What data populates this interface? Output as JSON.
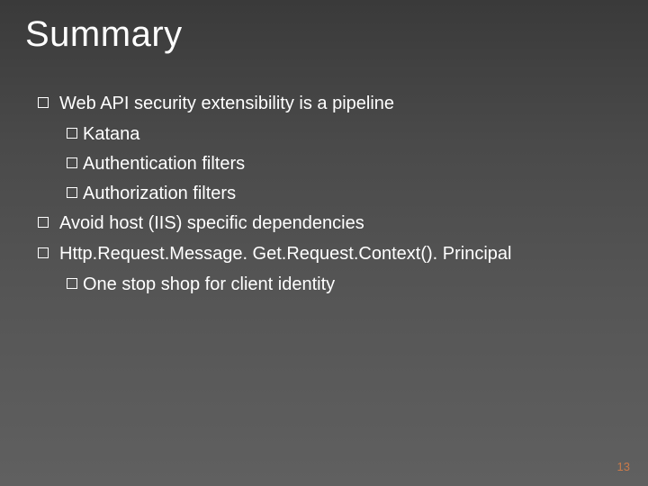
{
  "title": "Summary",
  "bullets": [
    {
      "text": "Web API security extensibility is a pipeline",
      "subs": [
        "Katana",
        "Authentication filters",
        "Authorization filters"
      ]
    },
    {
      "text": "Avoid host (IIS) specific dependencies",
      "subs": []
    },
    {
      "text": "Http.Request.Message. Get.Request.Context(). Principal",
      "subs": [
        "One stop shop for client identity"
      ]
    }
  ],
  "pageNumber": "13"
}
